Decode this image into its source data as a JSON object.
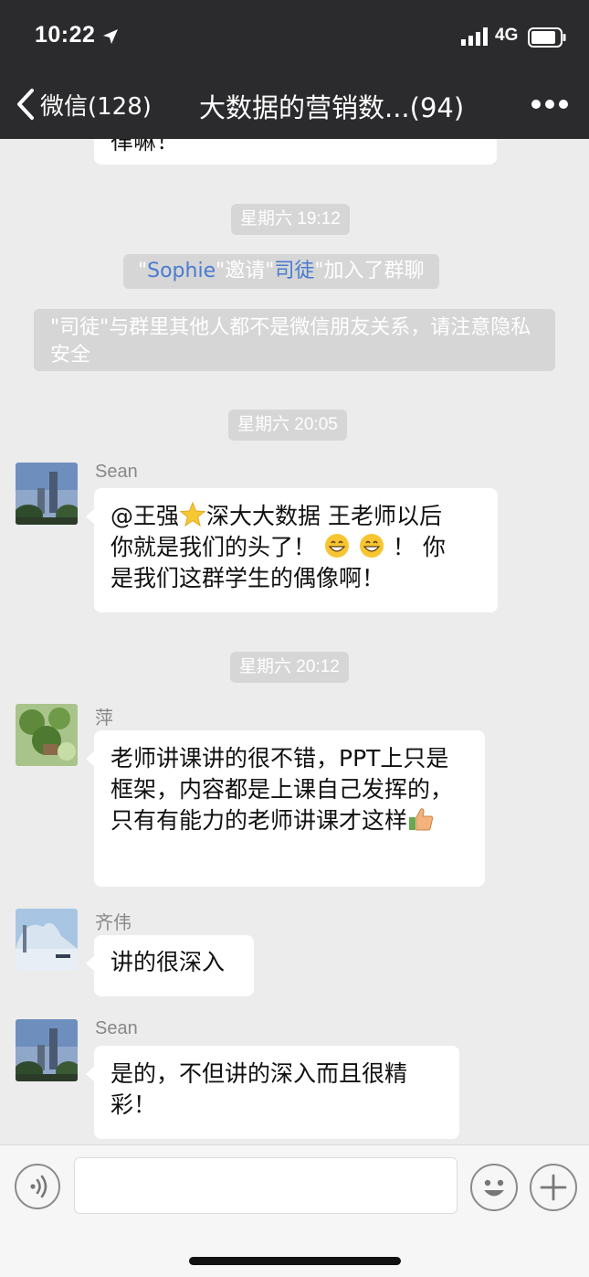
{
  "status_bar": {
    "time": "10:22",
    "network": "4G"
  },
  "nav": {
    "back_label": "微信(128)",
    "title": "大数据的营销数...(94)"
  },
  "messages": [
    {
      "type": "bubble",
      "sender": "",
      "text": "律嘛！"
    },
    {
      "type": "time",
      "text": "星期六 19:12"
    },
    {
      "type": "system",
      "parts": [
        "\"",
        "Sophie",
        "\"邀请\"",
        "司徒",
        "\"加入了群聊"
      ]
    },
    {
      "type": "system",
      "text": "\"司徒\"与群里其他人都不是微信朋友关系，请注意隐私安全"
    },
    {
      "type": "time",
      "text": "星期六 20:05"
    },
    {
      "type": "bubble",
      "sender": "Sean",
      "lines": [
        "@王强",
        "深大大数据 王老师以后",
        "你就是我们的头了！",
        "！ 你",
        "是我们这群学生的偶像啊！"
      ]
    },
    {
      "type": "time",
      "text": "星期六 20:12"
    },
    {
      "type": "bubble",
      "sender": "萍",
      "text": "老师讲课讲的很不错，PPT上只是框架，内容都是上课自己发挥的，只有有能力的老师讲课才这样"
    },
    {
      "type": "bubble",
      "sender": "齐伟",
      "text": "讲的很深入"
    },
    {
      "type": "bubble",
      "sender": "Sean",
      "text": "是的，不但讲的深入而且很精彩！"
    }
  ],
  "icons": {
    "voice": "voice-icon",
    "emoji": "emoji-icon",
    "plus": "plus-icon",
    "back": "chevron-left-icon",
    "more": "more-icon"
  },
  "colors": {
    "nav_bg": "#2b2b2d",
    "chat_bg": "#ececec",
    "link": "#4a7bd0"
  }
}
